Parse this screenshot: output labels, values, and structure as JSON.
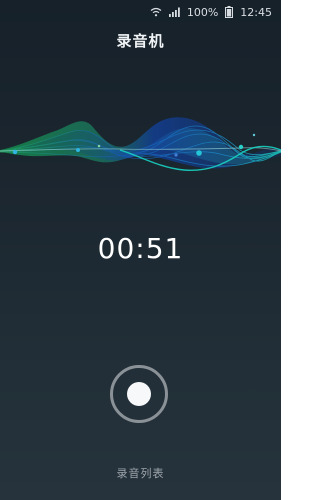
{
  "status_bar": {
    "battery_percent": "100%",
    "time": "12:45",
    "icons": [
      "wifi-icon",
      "signal-icon",
      "battery-icon"
    ]
  },
  "app": {
    "title": "录音机"
  },
  "recording": {
    "elapsed": "00:51"
  },
  "controls": {
    "record_button": "record-stop-icon",
    "record_list_label": "录音列表"
  },
  "colors": {
    "background_top": "#16212a",
    "background_bottom": "#26333c",
    "wave_green": "#1fa35a",
    "wave_blue": "#1556b5",
    "wave_cyan": "#19d3c2"
  }
}
